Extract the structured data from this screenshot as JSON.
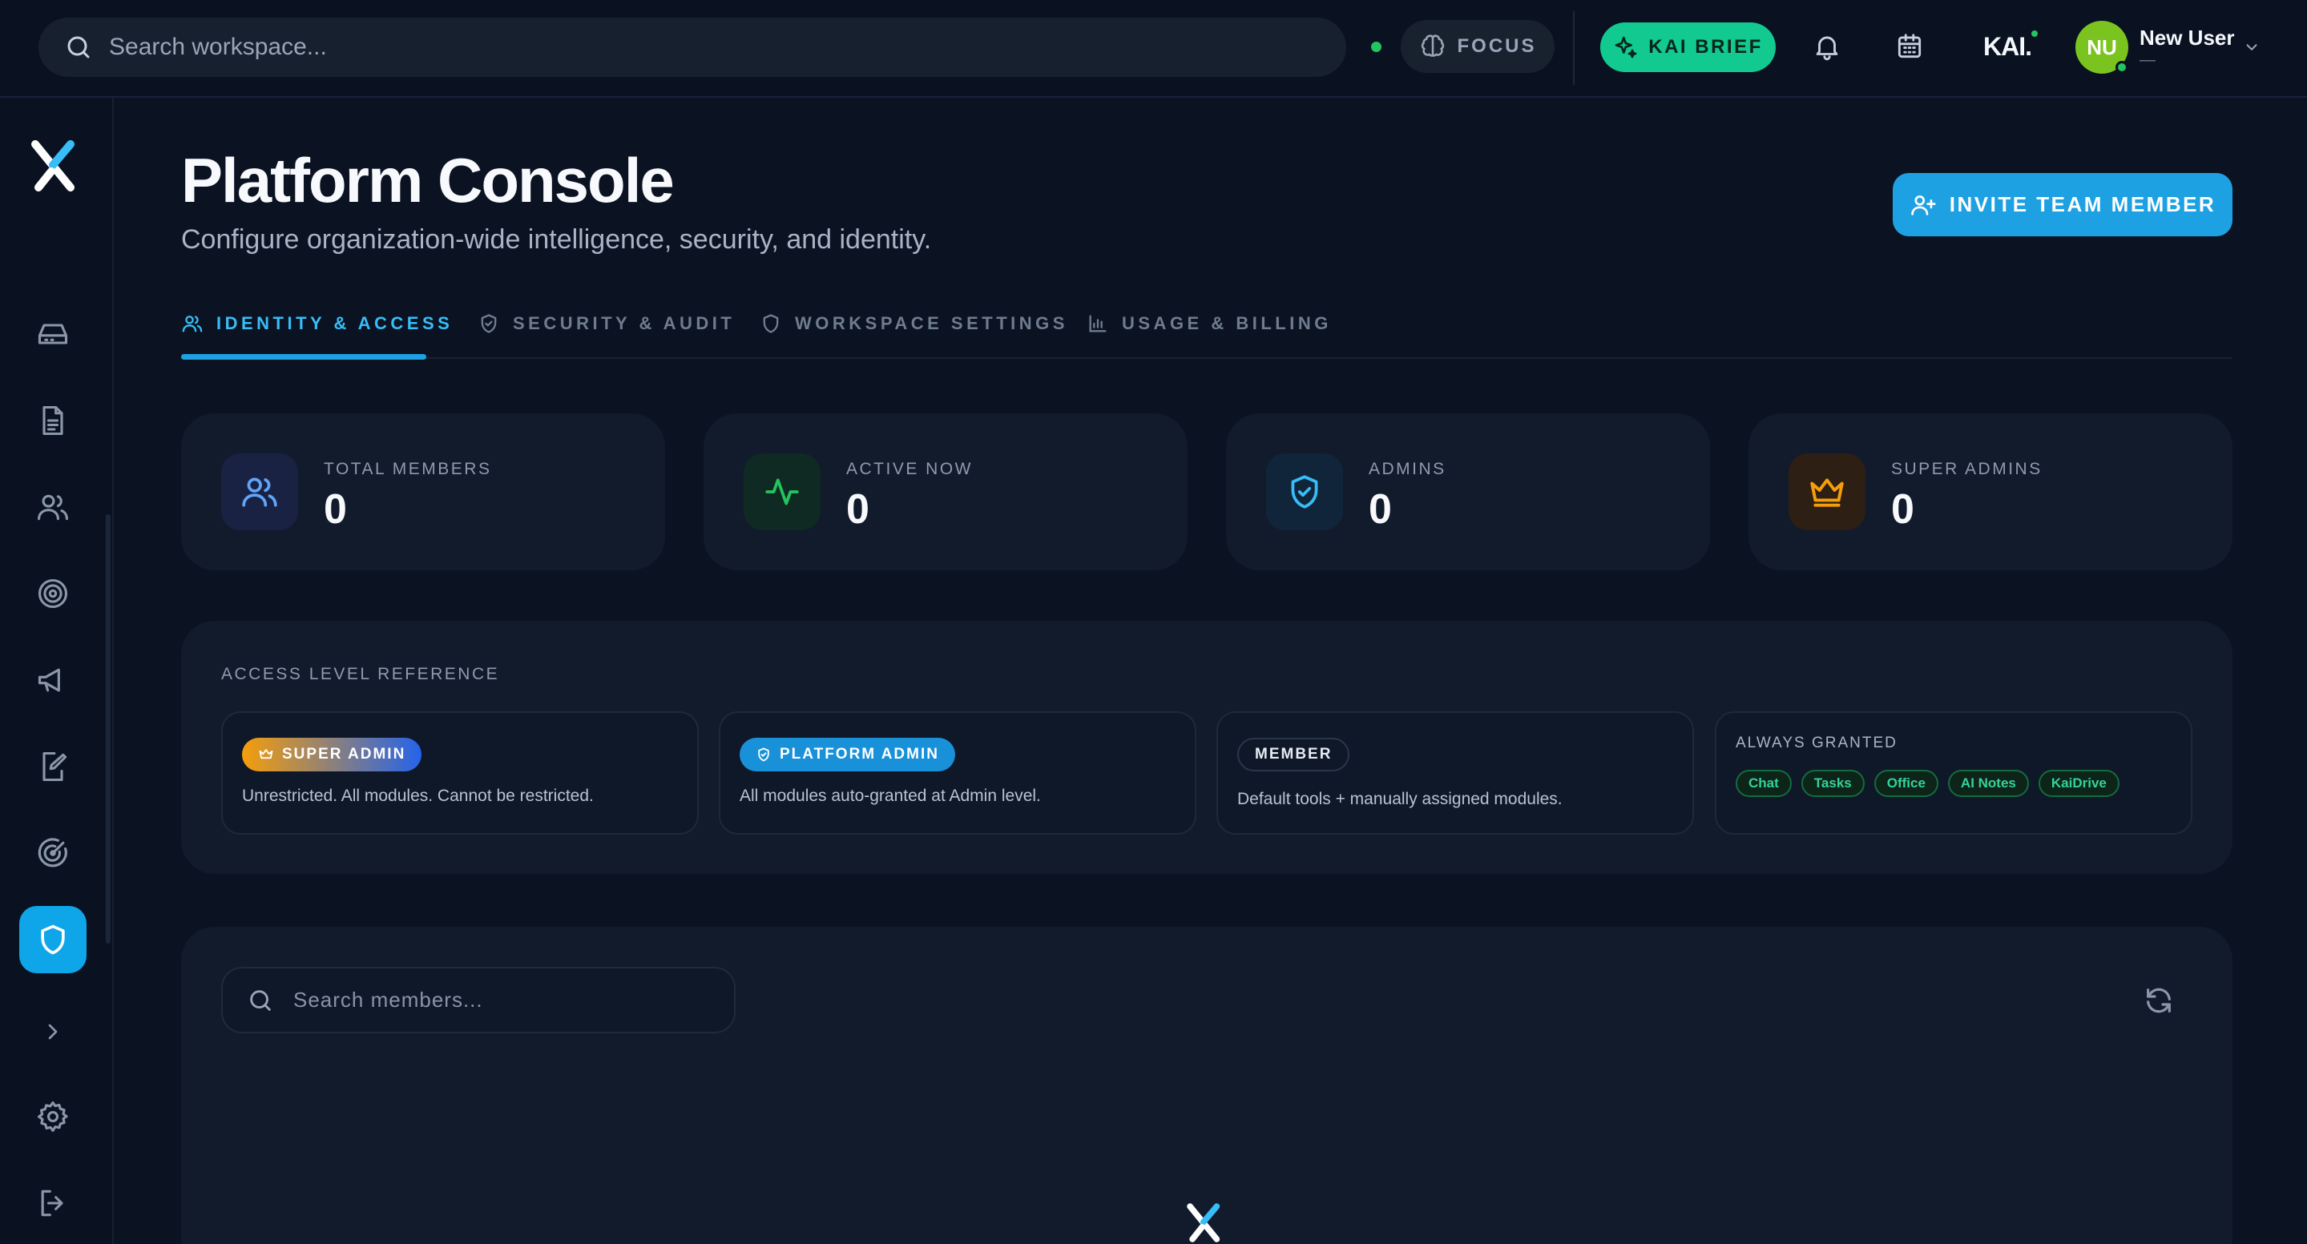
{
  "topbar": {
    "search_placeholder": "Search workspace...",
    "focus_label": "FOCUS",
    "brief_label": "KAI BRIEF",
    "brand_logo": "KAI.",
    "user": {
      "initials": "NU",
      "name": "New User",
      "subtitle": "—"
    }
  },
  "sidebar": {
    "items": [
      {
        "name": "inbox",
        "icon": "inbox-icon"
      },
      {
        "name": "documents",
        "icon": "document-icon"
      },
      {
        "name": "team",
        "icon": "users-icon"
      },
      {
        "name": "goals",
        "icon": "target-icon"
      },
      {
        "name": "announcements",
        "icon": "megaphone-icon"
      },
      {
        "name": "notes",
        "icon": "edit-icon"
      },
      {
        "name": "radar",
        "icon": "radar-icon"
      },
      {
        "name": "admin",
        "icon": "shield-icon",
        "active": true
      }
    ],
    "bottom": [
      {
        "name": "expand",
        "icon": "chevron-right-icon"
      },
      {
        "name": "settings",
        "icon": "gear-icon"
      },
      {
        "name": "logout",
        "icon": "logout-icon"
      }
    ]
  },
  "page": {
    "title": "Platform Console",
    "subtitle": "Configure organization-wide intelligence, security, and identity.",
    "invite_label": "INVITE TEAM MEMBER"
  },
  "tabs": [
    {
      "label": "IDENTITY & ACCESS",
      "icon": "users-icon",
      "active": true
    },
    {
      "label": "SECURITY & AUDIT",
      "icon": "shield-check-icon"
    },
    {
      "label": "WORKSPACE SETTINGS",
      "icon": "shield-icon"
    },
    {
      "label": "USAGE & BILLING",
      "icon": "bar-chart-icon"
    }
  ],
  "stats": [
    {
      "label": "TOTAL MEMBERS",
      "value": "0",
      "icon": "users-icon",
      "color": "#60a5fa"
    },
    {
      "label": "ACTIVE NOW",
      "value": "0",
      "icon": "activity-icon",
      "color": "#22c55e"
    },
    {
      "label": "ADMINS",
      "value": "0",
      "icon": "shield-check-icon",
      "color": "#38bdf8"
    },
    {
      "label": "SUPER ADMINS",
      "value": "0",
      "icon": "crown-icon",
      "color": "#f59e0b"
    }
  ],
  "access_reference": {
    "title": "ACCESS LEVEL REFERENCE",
    "levels": [
      {
        "badge": "SUPER ADMIN",
        "desc": "Unrestricted. All modules. Cannot be restricted."
      },
      {
        "badge": "PLATFORM ADMIN",
        "desc": "All modules auto-granted at Admin level."
      },
      {
        "badge": "MEMBER",
        "desc": "Default tools + manually assigned modules."
      }
    ],
    "always_granted": {
      "title": "ALWAYS GRANTED",
      "modules": [
        "Chat",
        "Tasks",
        "Office",
        "AI Notes",
        "KaiDrive"
      ]
    }
  },
  "members": {
    "search_placeholder": "Search members..."
  },
  "colors": {
    "accent": "#1ea1e3",
    "brief": "#12c98f",
    "background": "#0b1322",
    "panel": "#111b2c"
  }
}
